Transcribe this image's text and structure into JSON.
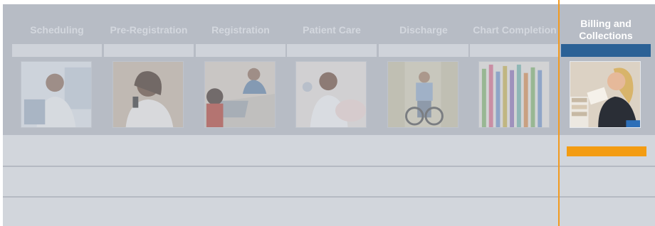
{
  "workflow": {
    "stages": [
      {
        "label": "Scheduling",
        "image": "receptionist-headset-photo"
      },
      {
        "label": "Pre-Registration",
        "image": "woman-on-phone-photo"
      },
      {
        "label": "Registration",
        "image": "registration-desk-photo"
      },
      {
        "label": "Patient Care",
        "image": "nurse-care-photo"
      },
      {
        "label": "Discharge",
        "image": "wheelchair-patient-photo"
      },
      {
        "label": "Chart Completion",
        "image": "chart-files-photo"
      },
      {
        "label": "Billing and Collections",
        "image": "billing-clerk-photo"
      }
    ],
    "active_stage": "Billing and Collections",
    "colors": {
      "active_bar": "#2b6196",
      "highlight": "#f39c12",
      "band": "#b7bcc5"
    }
  }
}
